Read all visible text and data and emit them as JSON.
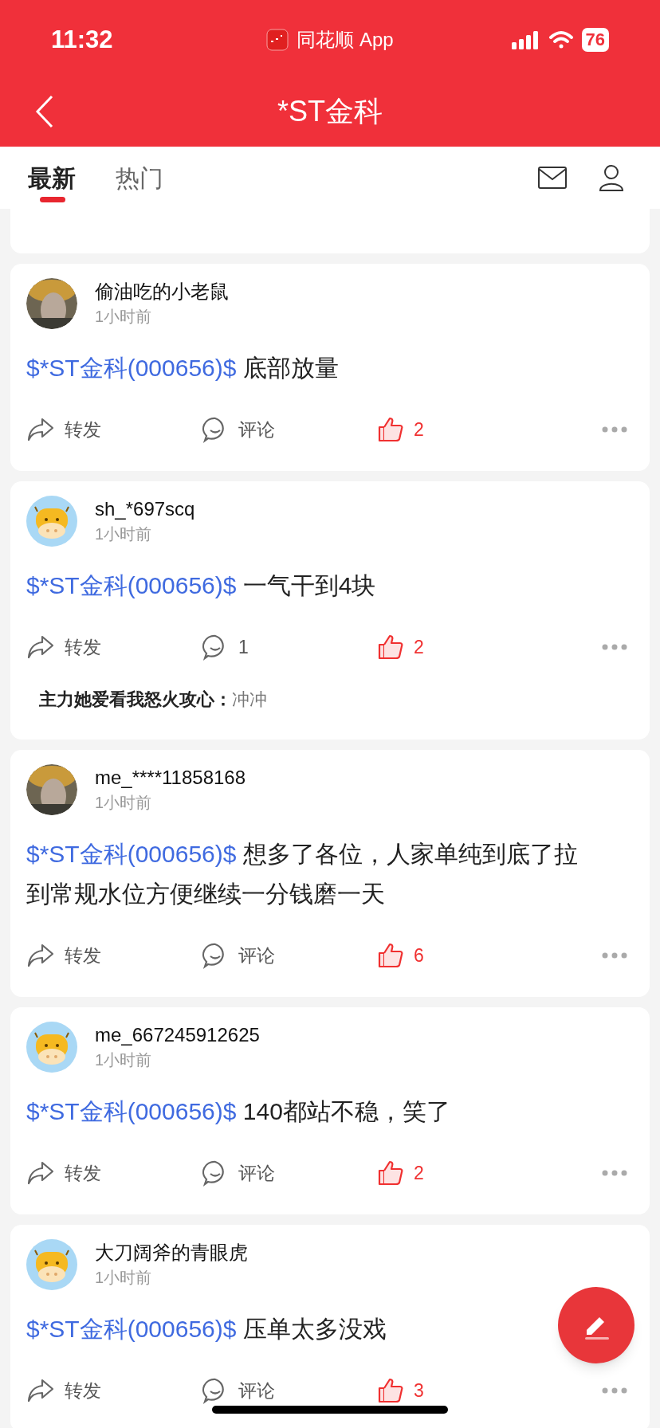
{
  "status_bar": {
    "time": "11:32",
    "app": "同花顺 App",
    "battery": "76"
  },
  "nav": {
    "title": "*ST金科"
  },
  "tabs": [
    {
      "label": "最新",
      "selected": true
    },
    {
      "label": "热门",
      "selected": false
    }
  ],
  "posts": [
    {
      "user": "偷油吃的小老鼠",
      "time": "1小时前",
      "stock_tag": "$*ST金科(000656)$",
      "text": "底部放量",
      "repost": "转发",
      "comment": "评论",
      "like": "2",
      "liked": true
    },
    {
      "avatar": {
        "kind": "cow"
      },
      "user": "sh_*697scq",
      "time": "1小时前",
      "stock_tag": "$*ST金科(000656)$",
      "text": "一气干到4块",
      "repost": "转发",
      "comment": "1",
      "like": "2",
      "liked": true,
      "replies": [
        {
          "author": "主力她爱看我怒火攻心：",
          "text": "冲冲"
        }
      ]
    },
    {
      "user": "me_****11858168",
      "time": "1小时前",
      "stock_tag": "$*ST金科(000656)$",
      "text": "想多了各位，人家单纯到底了拉到常规水位方便继续一分钱磨一天",
      "repost": "转发",
      "comment": "评论",
      "like": "6",
      "liked": true
    },
    {
      "avatar": {
        "kind": "cow"
      },
      "user": "me_667245912625",
      "time": "1小时前",
      "stock_tag": "$*ST金科(000656)$",
      "text": "140都站不稳，笑了",
      "repost": "转发",
      "comment": "评论",
      "like": "2",
      "liked": true
    },
    {
      "avatar": {
        "kind": "cow"
      },
      "user": "大刀阔斧的青眼虎",
      "time": "1小时前",
      "stock_tag": "$*ST金科(000656)$",
      "text": "压单太多没戏",
      "repost": "转发",
      "comment": "评论",
      "like": "3",
      "liked": true
    }
  ]
}
